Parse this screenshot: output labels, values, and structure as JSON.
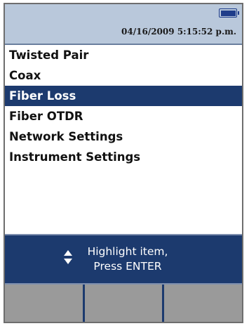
{
  "header": {
    "datetime": "04/16/2009 5:15:52 p.m.",
    "battery_icon": "battery-icon",
    "battery_level": 1.0
  },
  "menu": {
    "items": [
      {
        "label": "Twisted Pair",
        "selected": false
      },
      {
        "label": "Coax",
        "selected": false
      },
      {
        "label": "Fiber Loss",
        "selected": true
      },
      {
        "label": "Fiber OTDR",
        "selected": false
      },
      {
        "label": "Network Settings",
        "selected": false
      },
      {
        "label": "Instrument Settings",
        "selected": false
      }
    ]
  },
  "hint": {
    "icon": "up-down-arrows-icon",
    "line1": "Highlight item,",
    "line2": "Press ENTER"
  },
  "softkeys": [
    {
      "label": ""
    },
    {
      "label": ""
    },
    {
      "label": ""
    }
  ],
  "colors": {
    "header_bg": "#b9c8db",
    "selection_bg": "#1c3a6e",
    "softkey_bg": "#9a9a9a",
    "battery": "#1f3d8a"
  }
}
